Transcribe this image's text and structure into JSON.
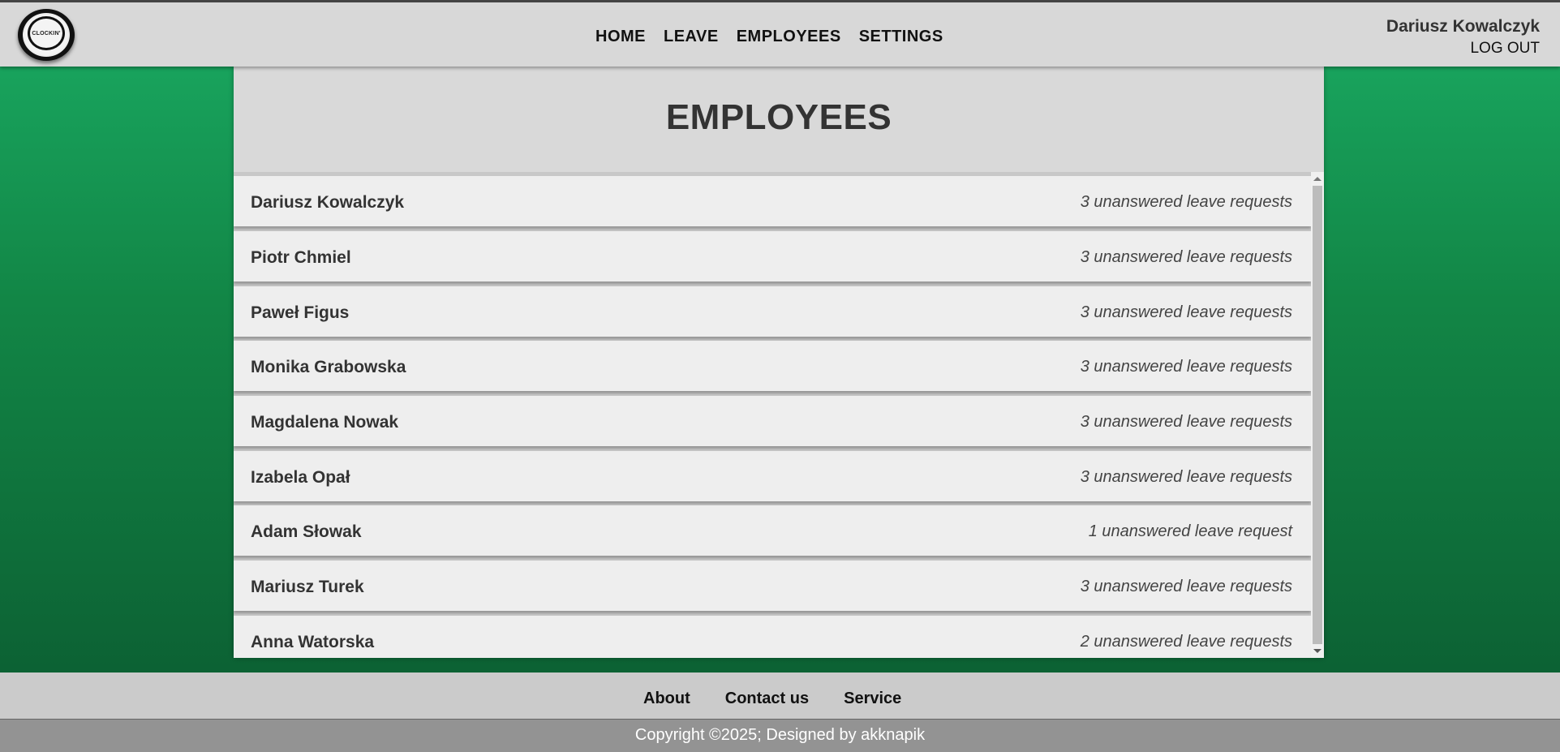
{
  "header": {
    "logo_text": "CLOCKIN'",
    "nav": [
      "HOME",
      "LEAVE",
      "EMPLOYEES",
      "SETTINGS"
    ],
    "user_name": "Dariusz Kowalczyk",
    "logout_label": "LOG OUT"
  },
  "main": {
    "title": "EMPLOYEES",
    "employees": [
      {
        "name": "Dariusz Kowalczyk",
        "requests": "3 unanswered leave requests"
      },
      {
        "name": "Piotr Chmiel",
        "requests": "3 unanswered leave requests"
      },
      {
        "name": "Paweł Figus",
        "requests": "3 unanswered leave requests"
      },
      {
        "name": "Monika Grabowska",
        "requests": "3 unanswered leave requests"
      },
      {
        "name": "Magdalena Nowak",
        "requests": "3 unanswered leave requests"
      },
      {
        "name": "Izabela Opał",
        "requests": "3 unanswered leave requests"
      },
      {
        "name": "Adam Słowak",
        "requests": "1 unanswered leave request"
      },
      {
        "name": "Mariusz Turek",
        "requests": "3 unanswered leave requests"
      },
      {
        "name": "Anna Watorska",
        "requests": "2 unanswered leave requests"
      }
    ]
  },
  "footer": {
    "links": [
      "About",
      "Contact us",
      "Service"
    ],
    "copyright": "Copyright ©2025; Designed by akknapik"
  }
}
